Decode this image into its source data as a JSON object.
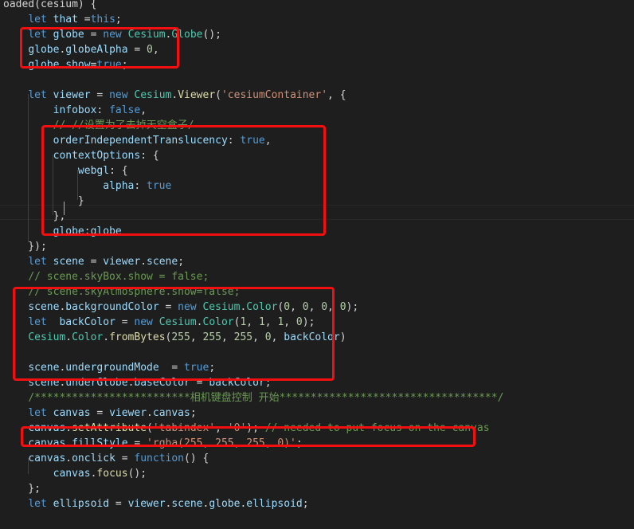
{
  "editor": {
    "theme_colors": {
      "background": "#1e1e1e",
      "keyword": "#569cd6",
      "variable": "#9cdcfe",
      "function": "#dcdcaa",
      "class": "#4ec9b0",
      "string": "#ce9178",
      "number": "#b5cea8",
      "comment": "#6a9955",
      "plain": "#d4d4d4",
      "highlight_box": "#f20f0f"
    },
    "lines": [
      [
        [
          "pl",
          "oaded(cesium) {"
        ]
      ],
      [
        [
          "pl",
          "    "
        ],
        [
          "kw",
          "let"
        ],
        [
          "pl",
          " "
        ],
        [
          "var",
          "that"
        ],
        [
          "pl",
          " ="
        ],
        [
          "kw",
          "this"
        ],
        [
          "pl",
          ";"
        ]
      ],
      [
        [
          "pl",
          "    "
        ],
        [
          "kw",
          "let"
        ],
        [
          "pl",
          " "
        ],
        [
          "var",
          "globe"
        ],
        [
          "pl",
          " = "
        ],
        [
          "kw",
          "new"
        ],
        [
          "pl",
          " "
        ],
        [
          "cls",
          "Cesium"
        ],
        [
          "pl",
          "."
        ],
        [
          "cls",
          "Globe"
        ],
        [
          "pl",
          "();"
        ]
      ],
      [
        [
          "pl",
          "    "
        ],
        [
          "var",
          "globe"
        ],
        [
          "pl",
          "."
        ],
        [
          "var",
          "globeAlpha"
        ],
        [
          "pl",
          " = "
        ],
        [
          "num",
          "0"
        ],
        [
          "pl",
          ","
        ]
      ],
      [
        [
          "pl",
          "    "
        ],
        [
          "var",
          "globe"
        ],
        [
          "pl",
          "."
        ],
        [
          "var",
          "show"
        ],
        [
          "pl",
          "="
        ],
        [
          "kw",
          "true"
        ],
        [
          "pl",
          ";"
        ]
      ],
      [],
      [
        [
          "pl",
          "    "
        ],
        [
          "kw",
          "let"
        ],
        [
          "pl",
          " "
        ],
        [
          "var",
          "viewer"
        ],
        [
          "pl",
          " = "
        ],
        [
          "kw",
          "new"
        ],
        [
          "pl",
          " "
        ],
        [
          "cls",
          "Cesium"
        ],
        [
          "pl",
          "."
        ],
        [
          "fn",
          "Viewer"
        ],
        [
          "pl",
          "("
        ],
        [
          "str",
          "'cesiumContainer'"
        ],
        [
          "pl",
          ", {"
        ]
      ],
      [
        [
          "pl",
          "        "
        ],
        [
          "var",
          "infobox"
        ],
        [
          "pl",
          ": "
        ],
        [
          "kw",
          "false"
        ],
        [
          "pl",
          ","
        ]
      ],
      [
        [
          "pl",
          "        "
        ],
        [
          "cm",
          "// //设置为了去掉天空盒子/"
        ]
      ],
      [
        [
          "pl",
          "        "
        ],
        [
          "var",
          "orderIndependentTranslucency"
        ],
        [
          "pl",
          ": "
        ],
        [
          "kw",
          "true"
        ],
        [
          "pl",
          ","
        ]
      ],
      [
        [
          "pl",
          "        "
        ],
        [
          "var",
          "contextOptions"
        ],
        [
          "pl",
          ": {"
        ]
      ],
      [
        [
          "pl",
          "            "
        ],
        [
          "var",
          "webgl"
        ],
        [
          "pl",
          ": {"
        ]
      ],
      [
        [
          "pl",
          "                "
        ],
        [
          "var",
          "alpha"
        ],
        [
          "pl",
          ": "
        ],
        [
          "kw",
          "true"
        ]
      ],
      [
        [
          "pl",
          "            }"
        ]
      ],
      [
        [
          "pl",
          "        },"
        ]
      ],
      [
        [
          "pl",
          "        "
        ],
        [
          "var",
          "globe"
        ],
        [
          "pl",
          ":"
        ],
        [
          "var",
          "globe"
        ]
      ],
      [
        [
          "pl",
          "    });"
        ]
      ],
      [
        [
          "pl",
          "    "
        ],
        [
          "kw",
          "let"
        ],
        [
          "pl",
          " "
        ],
        [
          "var",
          "scene"
        ],
        [
          "pl",
          " = "
        ],
        [
          "var",
          "viewer"
        ],
        [
          "pl",
          "."
        ],
        [
          "var",
          "scene"
        ],
        [
          "pl",
          ";"
        ]
      ],
      [
        [
          "pl",
          "    "
        ],
        [
          "cm",
          "// scene.skyBox.show = false;"
        ]
      ],
      [
        [
          "pl",
          "    "
        ],
        [
          "cm",
          "// scene.skyAtmosphere.show=false;"
        ]
      ],
      [
        [
          "pl",
          "    "
        ],
        [
          "var",
          "scene"
        ],
        [
          "pl",
          "."
        ],
        [
          "var",
          "backgroundColor"
        ],
        [
          "pl",
          " = "
        ],
        [
          "kw",
          "new"
        ],
        [
          "pl",
          " "
        ],
        [
          "cls",
          "Cesium"
        ],
        [
          "pl",
          "."
        ],
        [
          "cls",
          "Color"
        ],
        [
          "pl",
          "("
        ],
        [
          "num",
          "0"
        ],
        [
          "pl",
          ", "
        ],
        [
          "num",
          "0"
        ],
        [
          "pl",
          ", "
        ],
        [
          "num",
          "0"
        ],
        [
          "pl",
          ", "
        ],
        [
          "num",
          "0"
        ],
        [
          "pl",
          ");"
        ]
      ],
      [
        [
          "pl",
          "    "
        ],
        [
          "kw",
          "let"
        ],
        [
          "pl",
          "  "
        ],
        [
          "var",
          "backColor"
        ],
        [
          "pl",
          " = "
        ],
        [
          "kw",
          "new"
        ],
        [
          "pl",
          " "
        ],
        [
          "cls",
          "Cesium"
        ],
        [
          "pl",
          "."
        ],
        [
          "cls",
          "Color"
        ],
        [
          "pl",
          "("
        ],
        [
          "num",
          "1"
        ],
        [
          "pl",
          ", "
        ],
        [
          "num",
          "1"
        ],
        [
          "pl",
          ", "
        ],
        [
          "num",
          "1"
        ],
        [
          "pl",
          ", "
        ],
        [
          "num",
          "0"
        ],
        [
          "pl",
          ");"
        ]
      ],
      [
        [
          "pl",
          "    "
        ],
        [
          "cls",
          "Cesium"
        ],
        [
          "pl",
          "."
        ],
        [
          "cls",
          "Color"
        ],
        [
          "pl",
          "."
        ],
        [
          "fn",
          "fromBytes"
        ],
        [
          "pl",
          "("
        ],
        [
          "num",
          "255"
        ],
        [
          "pl",
          ", "
        ],
        [
          "num",
          "255"
        ],
        [
          "pl",
          ", "
        ],
        [
          "num",
          "255"
        ],
        [
          "pl",
          ", "
        ],
        [
          "num",
          "0"
        ],
        [
          "pl",
          ", "
        ],
        [
          "var",
          "backColor"
        ],
        [
          "pl",
          ")"
        ]
      ],
      [],
      [
        [
          "pl",
          "    "
        ],
        [
          "var",
          "scene"
        ],
        [
          "pl",
          "."
        ],
        [
          "var",
          "undergroundMode"
        ],
        [
          "pl",
          "  = "
        ],
        [
          "kw",
          "true"
        ],
        [
          "pl",
          ";"
        ]
      ],
      [
        [
          "pl",
          "    "
        ],
        [
          "var",
          "scene"
        ],
        [
          "pl",
          "."
        ],
        [
          "var",
          "underGlobe"
        ],
        [
          "pl",
          "."
        ],
        [
          "var",
          "baseColor"
        ],
        [
          "pl",
          " = "
        ],
        [
          "var",
          "backColor"
        ],
        [
          "pl",
          ";"
        ]
      ],
      [
        [
          "pl",
          "    "
        ],
        [
          "cm",
          "/*************************相机键盘控制 开始***********************************/"
        ]
      ],
      [
        [
          "pl",
          "    "
        ],
        [
          "kw",
          "let"
        ],
        [
          "pl",
          " "
        ],
        [
          "var",
          "canvas"
        ],
        [
          "pl",
          " = "
        ],
        [
          "var",
          "viewer"
        ],
        [
          "pl",
          "."
        ],
        [
          "var",
          "canvas"
        ],
        [
          "pl",
          ";"
        ]
      ],
      [
        [
          "pl",
          "    "
        ],
        [
          "var",
          "canvas"
        ],
        [
          "pl",
          "."
        ],
        [
          "fn",
          "setAttribute"
        ],
        [
          "pl",
          "("
        ],
        [
          "str",
          "'tabindex'"
        ],
        [
          "pl",
          ", "
        ],
        [
          "str",
          "'0'"
        ],
        [
          "pl",
          "); "
        ],
        [
          "cm",
          "// needed to put focus on the canvas"
        ]
      ],
      [
        [
          "pl",
          "    "
        ],
        [
          "var",
          "canvas"
        ],
        [
          "pl",
          "."
        ],
        [
          "var",
          "fillStyle"
        ],
        [
          "pl",
          " = "
        ],
        [
          "str",
          "'rgba(255, 255, 255, 0)'"
        ],
        [
          "pl",
          ";"
        ]
      ],
      [
        [
          "pl",
          "    "
        ],
        [
          "var",
          "canvas"
        ],
        [
          "pl",
          "."
        ],
        [
          "var",
          "onclick"
        ],
        [
          "pl",
          " = "
        ],
        [
          "kw",
          "function"
        ],
        [
          "pl",
          "() {"
        ]
      ],
      [
        [
          "pl",
          "        "
        ],
        [
          "var",
          "canvas"
        ],
        [
          "pl",
          "."
        ],
        [
          "fn",
          "focus"
        ],
        [
          "pl",
          "();"
        ]
      ],
      [
        [
          "pl",
          "    };"
        ]
      ],
      [
        [
          "pl",
          "    "
        ],
        [
          "kw",
          "let"
        ],
        [
          "pl",
          " "
        ],
        [
          "var",
          "ellipsoid"
        ],
        [
          "pl",
          " = "
        ],
        [
          "var",
          "viewer"
        ],
        [
          "pl",
          "."
        ],
        [
          "var",
          "scene"
        ],
        [
          "pl",
          "."
        ],
        [
          "var",
          "globe"
        ],
        [
          "pl",
          "."
        ],
        [
          "var",
          "ellipsoid"
        ],
        [
          "pl",
          ";"
        ]
      ]
    ]
  }
}
